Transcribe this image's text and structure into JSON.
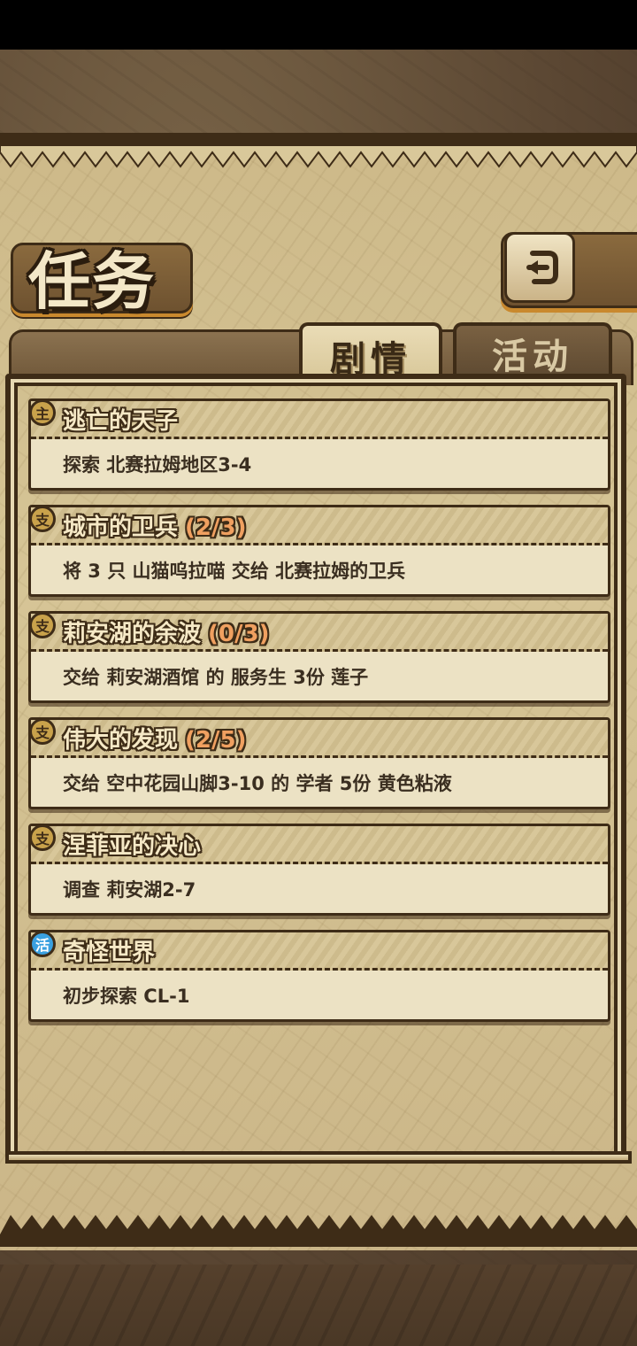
{
  "header": {
    "title": "任务"
  },
  "tabs": [
    {
      "label": "剧情",
      "active": true
    },
    {
      "label": "活动",
      "active": false
    }
  ],
  "quests": [
    {
      "badge": "主",
      "badge_color": "#c9a24b",
      "title": "逃亡的天子",
      "progress": "",
      "description": "探索 北赛拉姆地区3-4"
    },
    {
      "badge": "支",
      "badge_color": "#c9a24b",
      "title": "城市的卫兵",
      "progress": "(2/3)",
      "description": "将 3 只 山猫呜拉喵 交给 北赛拉姆的卫兵"
    },
    {
      "badge": "支",
      "badge_color": "#c9a24b",
      "title": "莉安湖的余波",
      "progress": "(0/3)",
      "description": "交给 莉安湖酒馆 的 服务生 3份 莲子"
    },
    {
      "badge": "支",
      "badge_color": "#c9a24b",
      "title": "伟大的发现",
      "progress": "(2/5)",
      "description": "交给 空中花园山脚3-10 的 学者 5份 黄色粘液"
    },
    {
      "badge": "支",
      "badge_color": "#c9a24b",
      "title": "涅菲亚的决心",
      "progress": "",
      "description": "调查 莉安湖2-7"
    },
    {
      "badge": "活",
      "badge_color": "#3aa0e0",
      "title": "奇怪世界",
      "progress": "",
      "description": "初步探索 CL-1"
    }
  ],
  "icons": {
    "back": "return-arrow-icon"
  }
}
